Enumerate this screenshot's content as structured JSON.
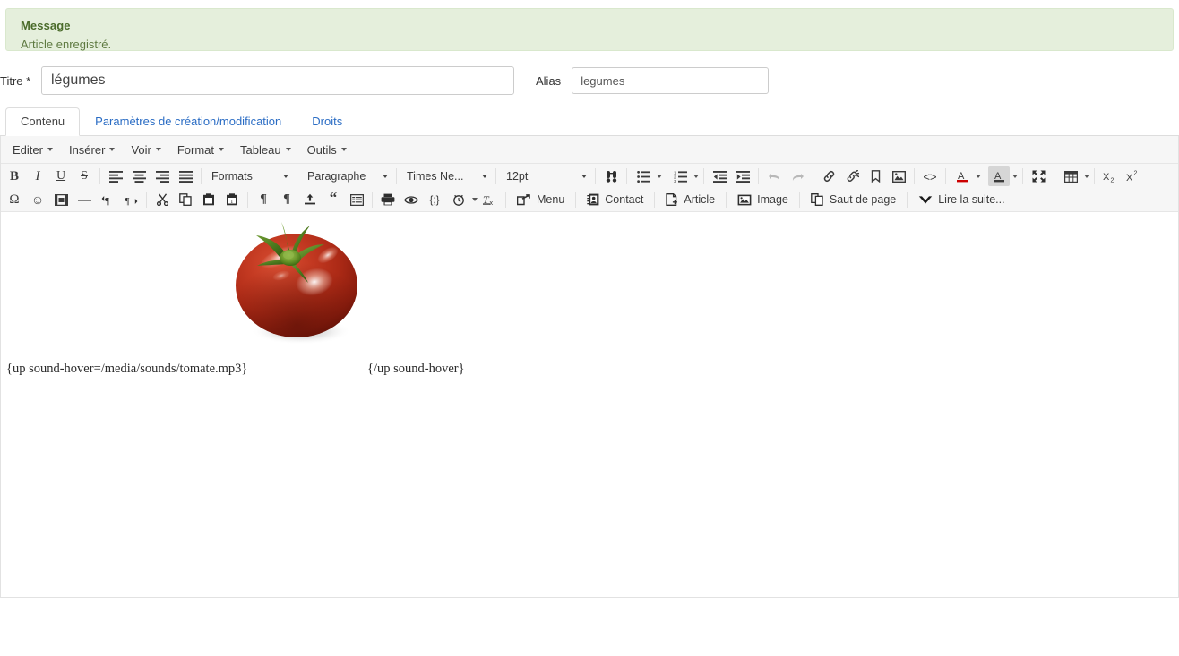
{
  "message": {
    "title": "Message",
    "body": "Article enregistré.",
    "bg_color": "#e5efdc",
    "title_color": "#4a6b2a"
  },
  "form": {
    "titre_label": "Titre *",
    "titre_value": "légumes",
    "titre_placeholder": "",
    "alias_label": "Alias",
    "alias_value": "legumes",
    "alias_placeholder": ""
  },
  "tabs": [
    {
      "label": "Contenu",
      "active": true
    },
    {
      "label": "Paramètres de création/modification",
      "active": false
    },
    {
      "label": "Droits",
      "active": false
    }
  ],
  "editor": {
    "menubar": [
      {
        "label": "Editer"
      },
      {
        "label": "Insérer"
      },
      {
        "label": "Voir"
      },
      {
        "label": "Format"
      },
      {
        "label": "Tableau"
      },
      {
        "label": "Outils"
      }
    ],
    "toolbar_row1": {
      "bold": "B",
      "italic": "I",
      "underline": "U",
      "strikethrough": "S",
      "formats_label": "Formats",
      "paragraph_label": "Paragraphe",
      "font_label": "Times Ne...",
      "size_label": "12pt"
    },
    "toolbar_row2": {
      "menu_label": "Menu",
      "contact_label": "Contact",
      "article_label": "Article",
      "image_label": "Image",
      "pagebreak_label": "Saut de page",
      "readmore_label": "Lire la suite..."
    }
  },
  "content": {
    "code_open": "{up sound-hover=/media/sounds/tomate.mp3}",
    "code_close": "{/up sound-hover}",
    "image_alt": "tomate"
  }
}
